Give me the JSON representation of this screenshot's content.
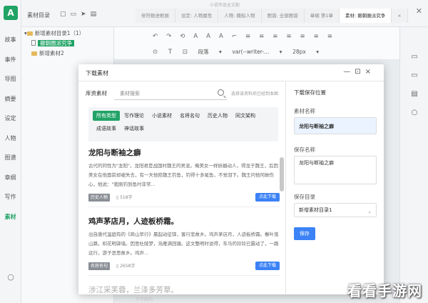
{
  "app": {
    "title": "小说作品全文配"
  },
  "rail": {
    "logo": "A",
    "items": [
      "故事",
      "事件",
      "导图",
      "摘要",
      "设定",
      "人物",
      "图谱",
      "章纲",
      "写作",
      "素材"
    ],
    "active_index": 9,
    "bottom_icon": "○"
  },
  "topbar": {
    "tree_title": "素材目录",
    "tabs": [
      "修符数进框展",
      "设定: 人物属性",
      "人物: 撒船人物",
      "图谱: 全部图谱",
      "章纲 第1章",
      "素材: 撤朝圈派究争",
      "×"
    ],
    "active_tab": 5
  },
  "tree": {
    "root": "新增素材目录1（1）",
    "child_selected": "撤朝圈派究争",
    "child2": "新增素材2"
  },
  "editor_toolbar": {
    "row1": [
      "↶",
      "↷",
      "⟲",
      "A",
      "A",
      "A",
      "⌐",
      "≡",
      "≡",
      "≡",
      "≡",
      "≡",
      "≡",
      "≡"
    ],
    "row2_icons": [
      "⊙",
      "T",
      "⊡"
    ],
    "paragraph_select": "段落",
    "font_select": "var(--writer-...",
    "size_select": "28px"
  },
  "modal": {
    "title": "下载素材",
    "controls": [
      "—",
      "⊡",
      "×"
    ],
    "library_label": "库资素材",
    "search_placeholder": "素材搜索",
    "search_hint": "选择该资料后已经到本图",
    "categories": [
      "所有类型",
      "写作理论",
      "小说素材",
      "名将名句",
      "历史人物",
      "同文架构",
      "成语故事",
      "神话故事"
    ],
    "active_category": 0,
    "items": [
      {
        "title": "龙阳与断袖之癖",
        "body": "古代的同性为\"龙阳\"，龙阳君是战国时魏王的男宠。俺美女一样妖媚动人，得龙于魏王，后因美女在他面前却被失去，有一天他陪魏王钓鱼，钓得十多尾鱼，不觉泪下。魏王问他何故伤心，他说：\"我刚钓到鱼时非常...",
        "tag": "历史人物",
        "words": "518字",
        "download": "点此下载"
      },
      {
        "title": "鸡声茅店月，人迹板桥霜。",
        "body": "出自唐代温庭筠的《商山早行》晨起动征铎，客行悲故乡。鸡声茅店月，人迹板桥霜。槲叶落山路，枳花明驿墙。因思杜陵梦，凫雁满回塘。这文整明时说得，车马的铃铃已震动了，一路远行，游子恶思故乡。鸡声...",
        "tag": "名将名句",
        "words": "2658字",
        "download": "点此下载"
      },
      {
        "title": "涉江采芙蓉，兰泽多芳草。"
      }
    ],
    "right": {
      "heading": "下载保存位置",
      "name_label": "素材名称",
      "name_value": "龙阳与断袖之癖",
      "save_name_label": "保存名称",
      "save_name_value": "龙阳与断袖之癖",
      "dir_label": "保存目录",
      "dir_value": "新增素材目录1",
      "save_button": "保存"
    }
  },
  "footer": {
    "faint": "宁宁的内"
  },
  "watermark": "看看手游网"
}
